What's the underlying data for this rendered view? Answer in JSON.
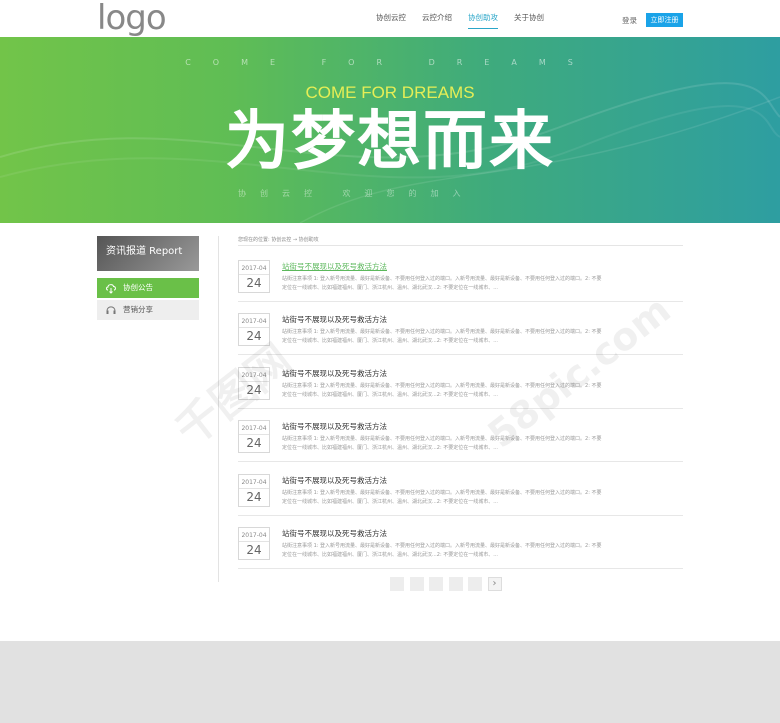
{
  "header": {
    "logo": "logo",
    "nav": [
      "协创云控",
      "云控介绍",
      "协创助攻",
      "关于协创"
    ],
    "login": "登录",
    "register": "立即注册"
  },
  "banner": {
    "spaced": "COME FOR DREAMS",
    "sub": "COME FOR DREAMS",
    "title": "为梦想而来",
    "tagline": "协创云控 欢迎您的加入"
  },
  "sidebar": {
    "head": "资讯报道 Report",
    "items": [
      "协创公告",
      "营销分享"
    ]
  },
  "breadcrumb": "您现在的位置: 协创云控 → 协创助攻",
  "news": [
    {
      "ym": "2017-04",
      "day": "24",
      "title": "站街号不展现以及死号救活方法",
      "desc": "站街注意事项 1: 登入新号用流量、最好是新设备、不要用任何登入过的端口。入新号用流量、最好是新设备、不要用任何登入过的端口。2: 不要定位在一线城市、比如福建福州、厦门、浙江杭州、温州、湖北武汉...2: 不要定位在一线城市、..."
    },
    {
      "ym": "2017-04",
      "day": "24",
      "title": "站街号不展现以及死号救活方法",
      "desc": "站街注意事项 1: 登入新号用流量、最好是新设备、不要用任何登入过的端口。入新号用流量、最好是新设备、不要用任何登入过的端口。2: 不要定位在一线城市、比如福建福州、厦门、浙江杭州、温州、湖北武汉...2: 不要定位在一线城市、..."
    },
    {
      "ym": "2017-04",
      "day": "24",
      "title": "站街号不展现以及死号救活方法",
      "desc": "站街注意事项 1: 登入新号用流量、最好是新设备、不要用任何登入过的端口。入新号用流量、最好是新设备、不要用任何登入过的端口。2: 不要定位在一线城市、比如福建福州、厦门、浙江杭州、温州、湖北武汉...2: 不要定位在一线城市、..."
    },
    {
      "ym": "2017-04",
      "day": "24",
      "title": "站街号不展现以及死号救活方法",
      "desc": "站街注意事项 1: 登入新号用流量、最好是新设备、不要用任何登入过的端口。入新号用流量、最好是新设备、不要用任何登入过的端口。2: 不要定位在一线城市、比如福建福州、厦门、浙江杭州、温州、湖北武汉...2: 不要定位在一线城市、..."
    },
    {
      "ym": "2017-04",
      "day": "24",
      "title": "站街号不展现以及死号救活方法",
      "desc": "站街注意事项 1: 登入新号用流量、最好是新设备、不要用任何登入过的端口。入新号用流量、最好是新设备、不要用任何登入过的端口。2: 不要定位在一线城市、比如福建福州、厦门、浙江杭州、温州、湖北武汉...2: 不要定位在一线城市、..."
    },
    {
      "ym": "2017-04",
      "day": "24",
      "title": "站街号不展现以及死号救活方法",
      "desc": "站街注意事项 1: 登入新号用流量、最好是新设备、不要用任何登入过的端口。入新号用流量、最好是新设备、不要用任何登入过的端口。2: 不要定位在一线城市、比如福建福州、厦门、浙江杭州、温州、湖北武汉...2: 不要定位在一线城市、..."
    }
  ],
  "pager": {
    "next": "›"
  },
  "watermarks": [
    "千图网",
    "58pic.com"
  ],
  "colors": {
    "accent": "#2aa6c9",
    "green": "#6ac048",
    "register": "#1aa3e8"
  }
}
